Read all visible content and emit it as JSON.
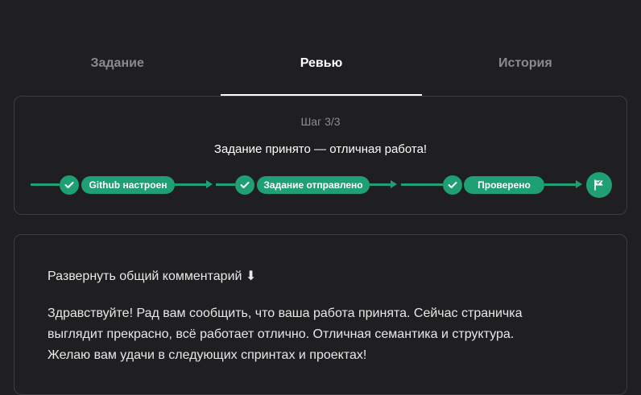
{
  "tabs": [
    {
      "label": "Задание",
      "active": false
    },
    {
      "label": "Ревью",
      "active": true
    },
    {
      "label": "История",
      "active": false
    }
  ],
  "review": {
    "step_counter": "Шаг 3/3",
    "status_text": "Задание принято — отличная работа!",
    "steps": [
      {
        "label": "Github настроен",
        "done": true
      },
      {
        "label": "Задание отправлено",
        "done": true
      },
      {
        "label": "Проверено",
        "done": true
      }
    ],
    "finish_icon": "flag-icon"
  },
  "comment": {
    "expand_label": "Развернуть общий комментарий ⬇",
    "lines": [
      "Здравствуйте! Рад вам сообщить, что ваша работа принята. Сейчас страничка",
      "выглядит прекрасно, всё работает отлично. Отличная семантика и структура.",
      "Желаю вам удачи в следующих спринтах и проектах!"
    ]
  },
  "colors": {
    "background": "#1f1f21",
    "accent": "#1f9f74",
    "border": "#3e3e42",
    "muted_text": "#8b8b8d"
  }
}
